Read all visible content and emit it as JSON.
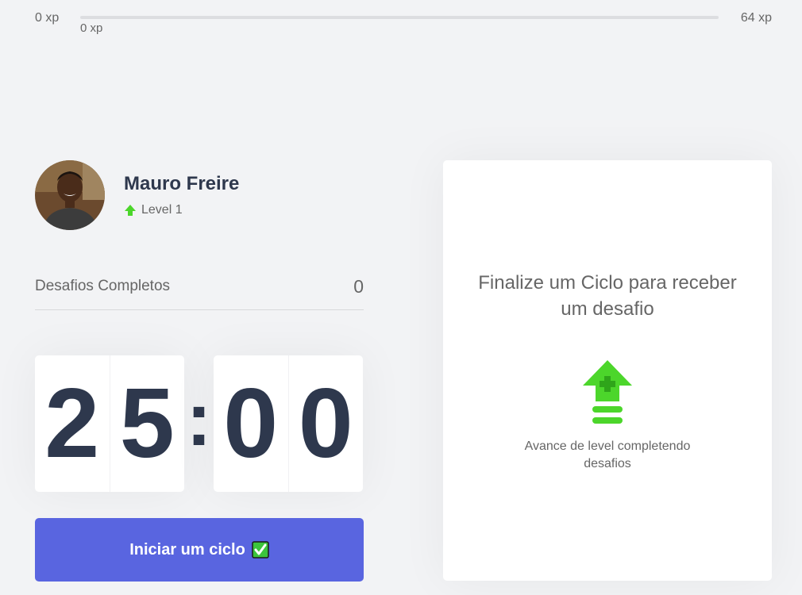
{
  "xp": {
    "min_label": "0 xp",
    "max_label": "64 xp",
    "current_label": "0 xp",
    "progress_fraction": 0
  },
  "profile": {
    "name": "Mauro Freire",
    "level_label": "Level 1"
  },
  "challenges": {
    "label": "Desafios Completos",
    "count": "0"
  },
  "countdown": {
    "minute_left": "2",
    "minute_right": "5",
    "separator": ":",
    "second_left": "0",
    "second_right": "0"
  },
  "start_button": {
    "label": "Iniciar um ciclo"
  },
  "challenge_card": {
    "title": "Finalize um Ciclo para receber um desafio",
    "description": "Avance de level completendo desafios"
  },
  "colors": {
    "accent": "#5965e0",
    "green": "#4cd62b",
    "title": "#2e384d"
  },
  "icons": [
    "level-up-arrow-icon",
    "check-icon",
    "level-up-icon"
  ]
}
